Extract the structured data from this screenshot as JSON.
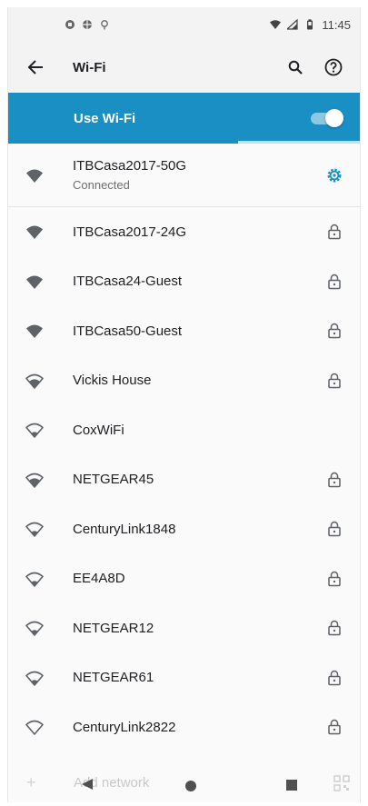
{
  "status_bar": {
    "time": "11:45"
  },
  "app_bar": {
    "title": "Wi-Fi"
  },
  "use_wifi": {
    "label": "Use Wi-Fi",
    "enabled": true,
    "scan_progress": 0.65
  },
  "networks": [
    {
      "ssid": "ITBCasa2017-50G",
      "status": "Connected",
      "signal": "strong",
      "locked": false,
      "settings": true
    },
    {
      "ssid": "ITBCasa2017-24G",
      "signal": "strong",
      "locked": true
    },
    {
      "ssid": "ITBCasa24-Guest",
      "signal": "strong",
      "locked": true
    },
    {
      "ssid": "ITBCasa50-Guest",
      "signal": "strong",
      "locked": true
    },
    {
      "ssid": "Vickis House",
      "signal": "medium",
      "locked": true
    },
    {
      "ssid": "CoxWiFi",
      "signal": "weak",
      "locked": false
    },
    {
      "ssid": "NETGEAR45",
      "signal": "medium",
      "locked": true
    },
    {
      "ssid": "CenturyLink1848",
      "signal": "weak",
      "locked": true
    },
    {
      "ssid": "EE4A8D",
      "signal": "weak",
      "locked": true
    },
    {
      "ssid": "NETGEAR12",
      "signal": "weak",
      "locked": true
    },
    {
      "ssid": "NETGEAR61",
      "signal": "weak",
      "locked": true
    },
    {
      "ssid": "CenturyLink2822",
      "signal": "empty",
      "locked": true
    }
  ],
  "footer": {
    "add_network": "Add network"
  },
  "colors": {
    "accent": "#1a8fc4",
    "icon": "#5f6368"
  }
}
